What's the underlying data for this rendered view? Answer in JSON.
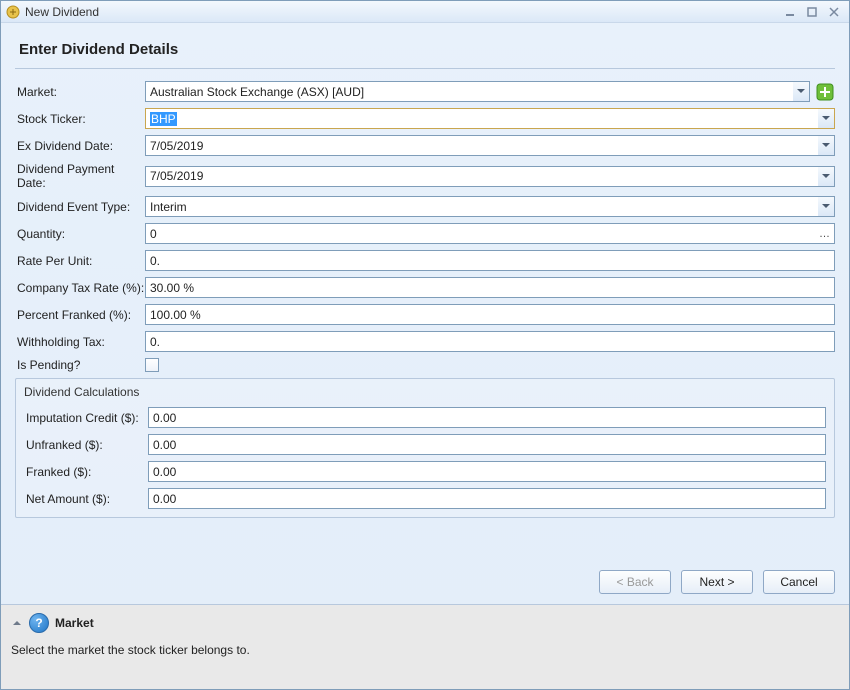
{
  "window": {
    "title": "New Dividend"
  },
  "header": {
    "title": "Enter Dividend Details"
  },
  "labels": {
    "market": "Market:",
    "ticker": "Stock Ticker:",
    "exdate": "Ex Dividend Date:",
    "paydate": "Dividend Payment Date:",
    "eventtype": "Dividend Event Type:",
    "quantity": "Quantity:",
    "rate": "Rate Per Unit:",
    "taxrate": "Company Tax Rate (%):",
    "pctfranked": "Percent Franked (%):",
    "wtax": "Withholding Tax:",
    "pending": "Is Pending?"
  },
  "values": {
    "market": "Australian Stock Exchange (ASX) [AUD]",
    "ticker": "BHP",
    "exdate": "7/05/2019",
    "paydate": "7/05/2019",
    "eventtype": "Interim",
    "quantity": "0",
    "rate": "0.",
    "taxrate": "30.00 %",
    "pctfranked": "100.00 %",
    "wtax": "0."
  },
  "calc": {
    "title": "Dividend Calculations",
    "imputation_lbl": "Imputation Credit ($):",
    "unfranked_lbl": "Unfranked ($):",
    "franked_lbl": "Franked ($):",
    "net_lbl": "Net Amount ($):",
    "imputation": "0.00",
    "unfranked": "0.00",
    "franked": "0.00",
    "net": "0.00"
  },
  "buttons": {
    "back": "< Back",
    "next": "Next >",
    "cancel": "Cancel"
  },
  "help": {
    "title": "Market",
    "body": "Select the market the stock ticker belongs to."
  }
}
